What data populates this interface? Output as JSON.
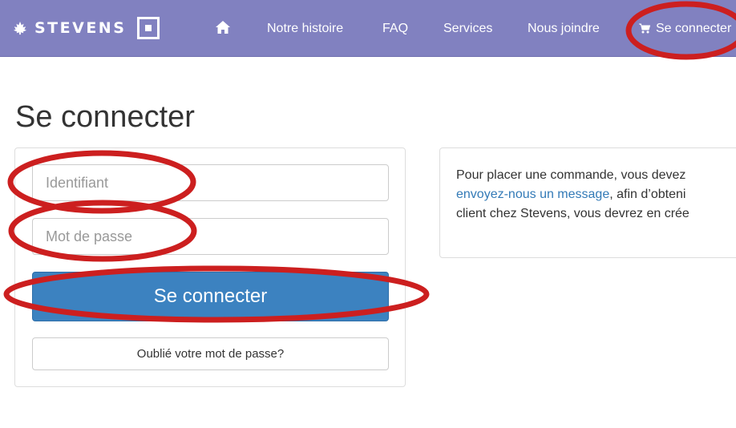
{
  "brand": {
    "name": "STEVENS"
  },
  "nav": {
    "home_icon": "home-icon",
    "links": [
      "Notre histoire",
      "FAQ",
      "Services",
      "Nous joindre"
    ],
    "login": "Se connecter",
    "cart_icon": "cart-icon"
  },
  "page": {
    "title": "Se connecter"
  },
  "login_form": {
    "username_placeholder": "Identifiant",
    "password_placeholder": "Mot de passe",
    "submit_label": "Se connecter",
    "forgot_label": "Oublié votre mot de passe?"
  },
  "info": {
    "line1": "Pour placer une commande, vous devez",
    "link": "envoyez-nous un message",
    "line2_rest": ", afin d’obteni",
    "line3": "client chez Stevens, vous devrez en crée"
  },
  "colors": {
    "navbar": "#8181c0",
    "primary": "#3c82c0",
    "link": "#337ab7",
    "annotation": "#cc1f1f"
  }
}
